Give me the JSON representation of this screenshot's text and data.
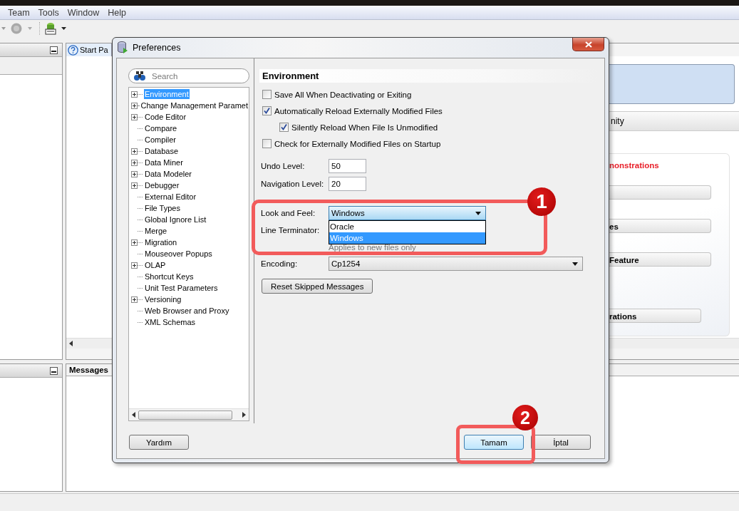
{
  "menu": [
    "Team",
    "Tools",
    "Window",
    "Help"
  ],
  "editor_tab": {
    "label": "Start Pa"
  },
  "start_page": {
    "tab_label": "nity",
    "section_title": "nonstrations",
    "buttons": [
      "es",
      "Feature",
      "rations"
    ]
  },
  "messages_panel": {
    "title": "Messages"
  },
  "dialog": {
    "title": "Preferences",
    "search": {
      "placeholder": "Search"
    },
    "tree": [
      {
        "label": "Environment",
        "kind": "folder",
        "selected": true
      },
      {
        "label": "Change Management Paramet",
        "kind": "folder",
        "selected": false
      },
      {
        "label": "Code Editor",
        "kind": "folder",
        "selected": false
      },
      {
        "label": "Compare",
        "kind": "leaf",
        "selected": false
      },
      {
        "label": "Compiler",
        "kind": "leaf",
        "selected": false
      },
      {
        "label": "Database",
        "kind": "folder",
        "selected": false
      },
      {
        "label": "Data Miner",
        "kind": "folder",
        "selected": false
      },
      {
        "label": "Data Modeler",
        "kind": "folder",
        "selected": false
      },
      {
        "label": "Debugger",
        "kind": "folder",
        "selected": false
      },
      {
        "label": "External Editor",
        "kind": "leaf",
        "selected": false
      },
      {
        "label": "File Types",
        "kind": "leaf",
        "selected": false
      },
      {
        "label": "Global Ignore List",
        "kind": "leaf",
        "selected": false
      },
      {
        "label": "Merge",
        "kind": "leaf",
        "selected": false
      },
      {
        "label": "Migration",
        "kind": "folder",
        "selected": false
      },
      {
        "label": "Mouseover Popups",
        "kind": "leaf",
        "selected": false
      },
      {
        "label": "OLAP",
        "kind": "folder",
        "selected": false
      },
      {
        "label": "Shortcut Keys",
        "kind": "leaf",
        "selected": false
      },
      {
        "label": "Unit Test Parameters",
        "kind": "leaf",
        "selected": false
      },
      {
        "label": "Versioning",
        "kind": "folder",
        "selected": false
      },
      {
        "label": "Web Browser and Proxy",
        "kind": "leaf",
        "selected": false
      },
      {
        "label": "XML Schemas",
        "kind": "leaf",
        "selected": false
      }
    ],
    "section_title": "Environment",
    "checkboxes": [
      {
        "label": "Save All When Deactivating or Exiting",
        "checked": false
      },
      {
        "label": "Automatically Reload Externally Modified Files",
        "checked": true,
        "children": [
          {
            "label": "Silently Reload When File Is Unmodified",
            "checked": true
          }
        ]
      },
      {
        "label": "Check for Externally Modified Files on Startup",
        "checked": false
      }
    ],
    "undo_level": {
      "label": "Undo Level:",
      "value": "50"
    },
    "navigation_level": {
      "label": "Navigation Level:",
      "value": "20"
    },
    "look_and_feel": {
      "label": "Look and Feel:",
      "value": "Windows",
      "expanded": true,
      "options": [
        {
          "label": "Oracle",
          "selected": false
        },
        {
          "label": "Windows",
          "selected": true
        }
      ]
    },
    "line_terminator": {
      "label": "Line Terminator:",
      "hint": "Applies to new files only"
    },
    "encoding": {
      "label": "Encoding:",
      "value": "Cp1254"
    },
    "reset_button": "Reset Skipped Messages",
    "buttons": [
      {
        "label": "Yardım",
        "default": false
      },
      {
        "label": "Tamam",
        "default": true
      },
      {
        "label": "İptal",
        "default": false
      }
    ]
  },
  "annotations": [
    {
      "number": "1"
    },
    {
      "number": "2"
    }
  ]
}
